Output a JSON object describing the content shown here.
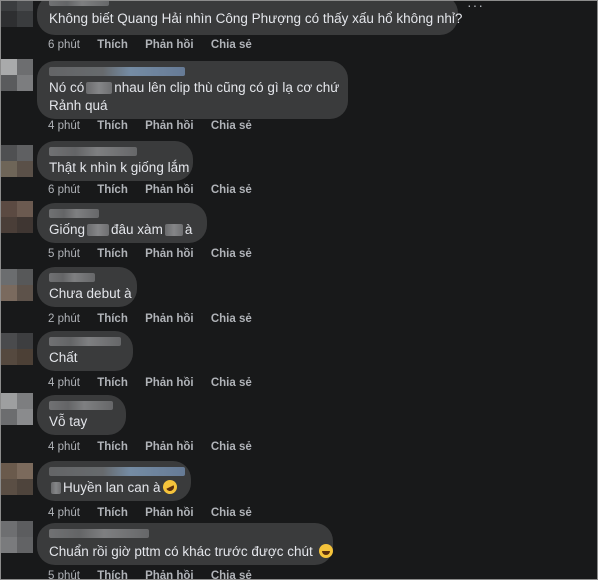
{
  "comments": [
    {
      "text": "Không biết Quang Hải nhìn Công Phượng có thấy xấu hổ không nhỉ?",
      "time": "6 phút"
    },
    {
      "text_line1_a": "Nó có",
      "text_line1_b": "nhau lên clip thù cũng có gì lạ cơ chứ",
      "text_line2": "Rảnh quá",
      "time": "4 phút"
    },
    {
      "text": "Thật k nhìn k giống lắm",
      "time": "6 phút"
    },
    {
      "text_a": "Giống",
      "text_b": "đâu xàm",
      "text_c": "à",
      "time": "5 phút"
    },
    {
      "text": "Chưa debut à",
      "time": "2 phút"
    },
    {
      "text": "Chất",
      "time": "4 phút"
    },
    {
      "text": "Vỗ tay",
      "time": "4 phút"
    },
    {
      "text": "Huyền lan can à",
      "time": "4 phút"
    },
    {
      "text": "Chuẩn rồi giờ pttm có khác trước được chút",
      "time": "5 phút"
    }
  ],
  "actions": {
    "like": "Thích",
    "reply": "Phản hồi",
    "share": "Chia sẻ"
  },
  "more_options": "···",
  "colors": {
    "background": "#18191a",
    "bubble": "#3a3b3c",
    "text": "#e4e6eb",
    "meta": "#b0b3b8"
  },
  "icons": {
    "laugh_emoji": "rolling-laughing-emoji",
    "grin_emoji": "grinning-sweat-emoji",
    "more": "more-options-icon"
  }
}
